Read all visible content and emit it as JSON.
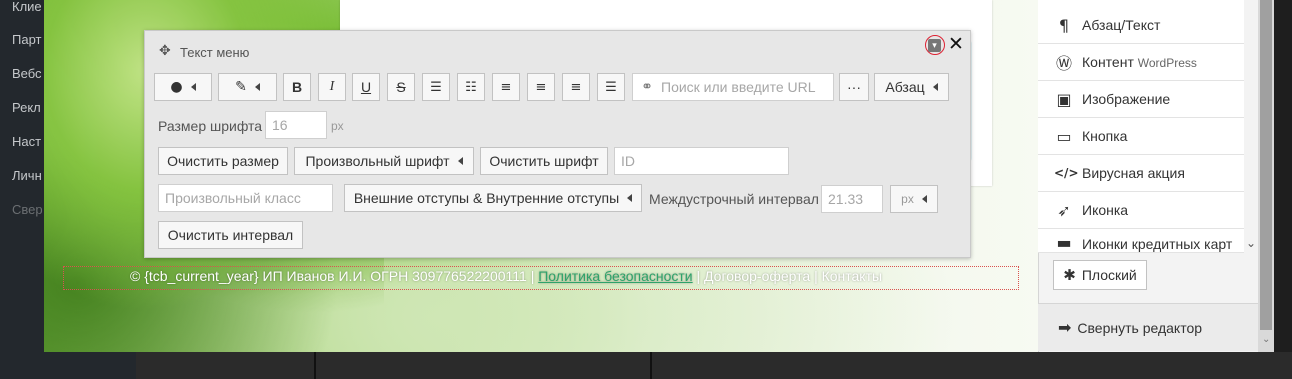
{
  "wp_sidebar": {
    "items": [
      "Клие",
      "Парт",
      "Вебс",
      "Рекл",
      "Наст",
      "Личн",
      "Свер"
    ]
  },
  "toolbar": {
    "title": "Текст меню",
    "row1": {
      "bold": "B",
      "italic": "I",
      "underline": "U",
      "strike": "S",
      "url_placeholder": "Поиск или введите URL",
      "more": "···",
      "paragraph": "Абзац"
    },
    "font_size_label": "Размер шрифта",
    "font_size_value": "16",
    "font_size_unit": "px",
    "clear_size": "Очистить размер",
    "custom_font": "Произвольный шрифт",
    "clear_font": "Очистить шрифт",
    "id_placeholder": "ID",
    "custom_class_placeholder": "Произвольный класс",
    "margins": "Внешние отступы & Внутренние отступы",
    "line_height_label": "Междустрочный интервал",
    "line_height_value": "21.33",
    "line_height_unit": "px",
    "clear_interval": "Очистить интервал"
  },
  "footer": {
    "prefix": "© {tcb_current_year} ИП Иванов И.И. ОГРН 309776522200111 | ",
    "link": "Политика безопасности",
    "suffix": " | Договор-оферта | Контакты"
  },
  "right_panel": {
    "items": [
      {
        "icon": "pilcrow-icon",
        "glyph": "¶",
        "label": "Абзац/Текст"
      },
      {
        "icon": "wordpress-icon",
        "glyph": "Ⓦ",
        "label": "Контент",
        "sub": "WordPress"
      },
      {
        "icon": "image-icon",
        "glyph": "▣",
        "label": "Изображение"
      },
      {
        "icon": "button-icon",
        "glyph": "▭",
        "label": "Кнопка"
      },
      {
        "icon": "code-icon",
        "glyph": "</>",
        "label": "Вирусная акция"
      },
      {
        "icon": "rocket-icon",
        "glyph": "➶",
        "label": "Иконка"
      },
      {
        "icon": "credit-card-icon",
        "glyph": "▬",
        "label": "Иконки кредитных карт"
      }
    ],
    "flat_label": "Плоский",
    "collapse_label": "Свернуть редактор"
  }
}
